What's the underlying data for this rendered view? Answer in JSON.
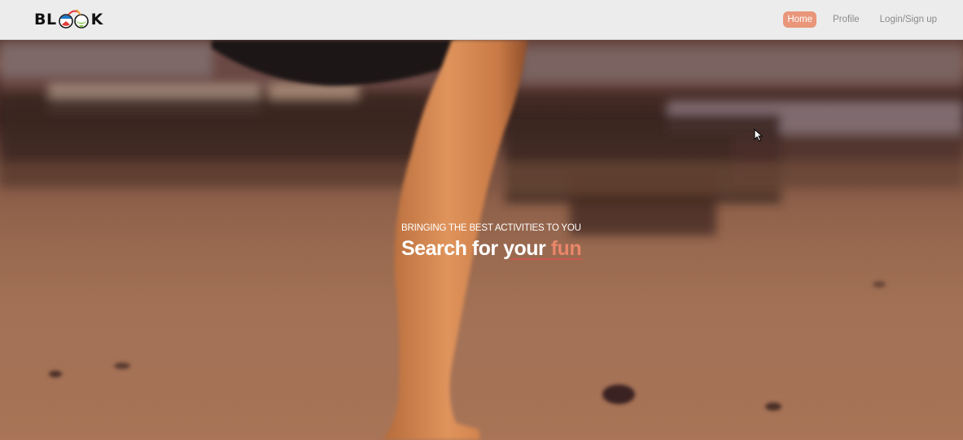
{
  "brand": {
    "name_left": "BL",
    "name_right": "K",
    "logo_icon": "beach-ball-coconut-logo"
  },
  "nav": {
    "items": [
      {
        "label": "Home",
        "active": true
      },
      {
        "label": "Profile",
        "active": false
      },
      {
        "label": "Login/Sign up",
        "active": false
      }
    ]
  },
  "hero": {
    "tagline": "BRINGING THE BEST ACTIVITIES TO YOU",
    "title_prefix": "Search for your ",
    "title_accent": "fun",
    "background": "beach-walk-video-background"
  },
  "colors": {
    "accent": "#e9967a",
    "header_bg": "#ececec",
    "nav_text": "#8a8a8a",
    "hero_text": "#ffffff",
    "underline": "#d9534f"
  }
}
